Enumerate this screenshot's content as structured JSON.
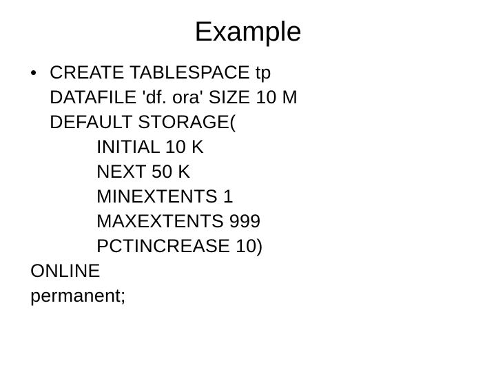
{
  "title": "Example",
  "code": {
    "line1": "CREATE TABLESPACE tp",
    "line2": "DATAFILE 'df. ora' SIZE 10 M",
    "line3": "DEFAULT STORAGE(",
    "line4": "INITIAL 10 K",
    "line5": "NEXT 50 K",
    "line6": "MINEXTENTS 1",
    "line7": "MAXEXTENTS 999",
    "line8": "PCTINCREASE 10)",
    "line9": "ONLINE",
    "line10": "permanent;"
  },
  "bullet_char": "•"
}
